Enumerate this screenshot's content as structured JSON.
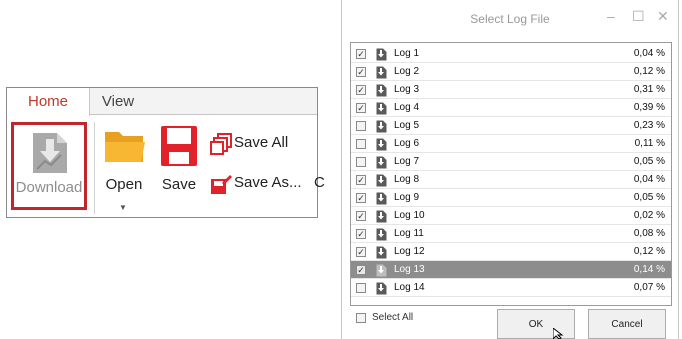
{
  "ribbon": {
    "tabs": [
      {
        "label": "Home",
        "active": true
      },
      {
        "label": "View",
        "active": false
      }
    ],
    "buttons": {
      "download": "Download",
      "open": "Open",
      "save": "Save",
      "save_all": "Save All",
      "save_as": "Save As...",
      "clipped_next": "C"
    },
    "colors": {
      "accent": "#c0272d",
      "folder": "#f5a623",
      "save_red": "#e2222a"
    }
  },
  "dialog": {
    "title": "Select Log File",
    "window_buttons": {
      "minimize": "–",
      "maximize": "☐",
      "close": "✕"
    },
    "logs": [
      {
        "name": "Log 1",
        "percent": "0,04 %",
        "checked": true,
        "selected": false
      },
      {
        "name": "Log 2",
        "percent": "0,12 %",
        "checked": true,
        "selected": false
      },
      {
        "name": "Log 3",
        "percent": "0,31 %",
        "checked": true,
        "selected": false
      },
      {
        "name": "Log 4",
        "percent": "0,39 %",
        "checked": true,
        "selected": false
      },
      {
        "name": "Log 5",
        "percent": "0,23 %",
        "checked": false,
        "selected": false
      },
      {
        "name": "Log 6",
        "percent": "0,11 %",
        "checked": false,
        "selected": false
      },
      {
        "name": "Log 7",
        "percent": "0,05 %",
        "checked": false,
        "selected": false
      },
      {
        "name": "Log 8",
        "percent": "0,04 %",
        "checked": true,
        "selected": false
      },
      {
        "name": "Log 9",
        "percent": "0,05 %",
        "checked": true,
        "selected": false
      },
      {
        "name": "Log 10",
        "percent": "0,02 %",
        "checked": true,
        "selected": false
      },
      {
        "name": "Log 11",
        "percent": "0,08 %",
        "checked": true,
        "selected": false
      },
      {
        "name": "Log 12",
        "percent": "0,12 %",
        "checked": true,
        "selected": false
      },
      {
        "name": "Log 13",
        "percent": "0,14 %",
        "checked": true,
        "selected": true
      },
      {
        "name": "Log 14",
        "percent": "0,07 %",
        "checked": false,
        "selected": false
      }
    ],
    "select_all": {
      "label": "Select All",
      "checked": false
    },
    "ok_label": "OK",
    "cancel_label": "Cancel",
    "colors": {
      "selected_row": "#8d8d8d"
    }
  }
}
